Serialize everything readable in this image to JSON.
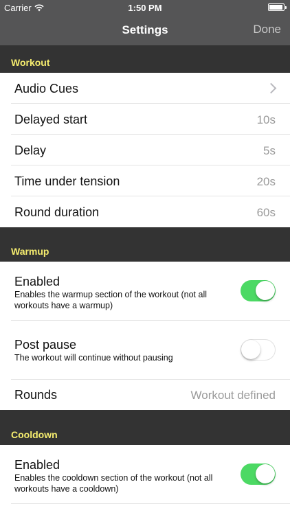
{
  "status_bar": {
    "carrier": "Carrier",
    "time": "1:50 PM"
  },
  "nav": {
    "title": "Settings",
    "done_label": "Done"
  },
  "sections": {
    "workout": {
      "header": "Workout",
      "rows": {
        "audio_cues": {
          "label": "Audio Cues"
        },
        "delayed_start": {
          "label": "Delayed start",
          "value": "10s"
        },
        "delay": {
          "label": "Delay",
          "value": "5s"
        },
        "time_under_tension": {
          "label": "Time under tension",
          "value": "20s"
        },
        "round_duration": {
          "label": "Round duration",
          "value": "60s"
        }
      }
    },
    "warmup": {
      "header": "Warmup",
      "rows": {
        "enabled": {
          "label": "Enabled",
          "description": "Enables the warmup section of the workout (not all workouts have a warmup)",
          "toggle": true
        },
        "post_pause": {
          "label": "Post pause",
          "description": "The workout will continue without pausing",
          "toggle": false
        },
        "rounds": {
          "label": "Rounds",
          "value": "Workout defined"
        }
      }
    },
    "cooldown": {
      "header": "Cooldown",
      "rows": {
        "enabled": {
          "label": "Enabled",
          "description": "Enables the cooldown section of the workout (not all workouts have a cooldown)",
          "toggle": true
        }
      }
    }
  },
  "colors": {
    "header_bg": "#555556",
    "section_bg": "#333333",
    "section_text": "#f7ee6f",
    "toggle_on": "#4cd964"
  }
}
